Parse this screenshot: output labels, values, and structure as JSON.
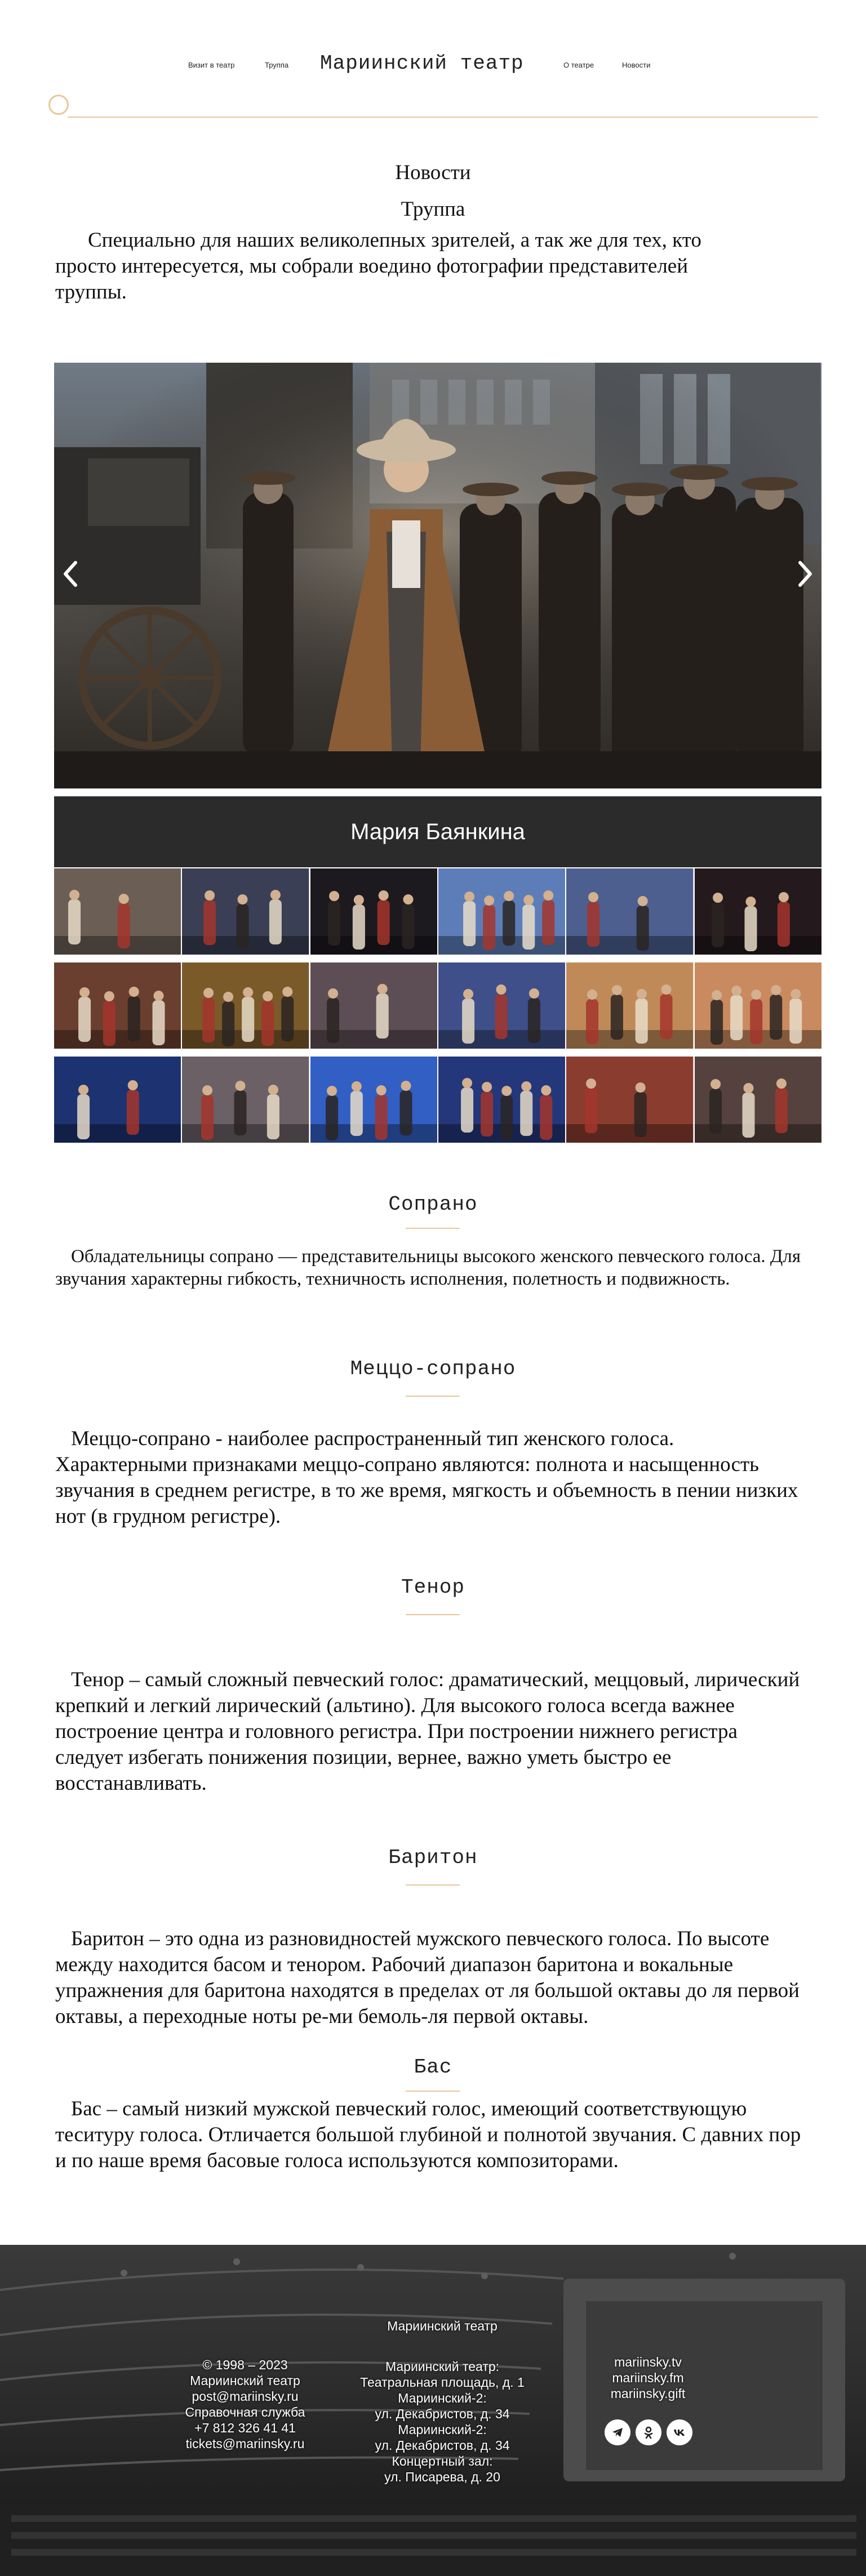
{
  "header": {
    "site_title": "Мариинский театр",
    "nav": {
      "visit": "Визит в театр",
      "troupe": "Труппа",
      "about": "О театре",
      "news": "Новости"
    }
  },
  "intro": {
    "news_heading": "Новости",
    "troupe_heading": "Труппа",
    "text": "Специально для наших великолепных зрителей, а так же для тех, кто просто интересуется, мы собрали воедино фотографии представителей труппы."
  },
  "slider": {
    "caption": "Мария Баянкина",
    "prev_icon": "chevron-left-icon",
    "next_icon": "chevron-right-icon"
  },
  "thumbnails": {
    "count": 18,
    "colors": [
      "#6b5f55",
      "#3a3f55",
      "#1c1a1f",
      "#5d7db8",
      "#4c5f8f",
      "#24191c",
      "#6a3f2f",
      "#7b5a2a",
      "#5d4e55",
      "#3e4f8a",
      "#c08a58",
      "#c98a5f",
      "#1d3270",
      "#6b6066",
      "#315fc3",
      "#23377a",
      "#8a3c2e",
      "#55423e"
    ]
  },
  "sections": {
    "soprano": {
      "title": "Сопрано",
      "text": "Обладательницы сопрано — представительницы высокого женского певческого голоса. Для звучания характерны гибкость, техничность исполнения, полетность и подвижность."
    },
    "mezzo": {
      "title": "Меццо-сопрано",
      "text": "Меццо-сопрано - наиболее распространенный тип женского голоса. Характерными признаками меццо-сопрано являются: полнота и насыщенность звучания в среднем регистре, в то же время, мягкость и объемность в пении низких нот (в грудном регистре)."
    },
    "tenor": {
      "title": "Тенор",
      "text": "Тенор – самый сложный певческий голос: драматический, меццовый, лирический крепкий и легкий лирический (альтино). Для высокого голоса всегда важнее построение центра и головного регистра. При построении нижнего регистра следует избегать понижения позиции, вернее, важно уметь быстро ее восстанавливать."
    },
    "baritone": {
      "title": "Баритон",
      "text": "Баритон – это одна из разновидностей мужского певческого голоса. По высоте между находится басом и тенором. Рабочий диапазон баритона и вокальные упражнения для баритона находятся в пределах от ля большой октавы до ля первой октавы, а переходные ноты ре-ми бемоль-ля первой октавы."
    },
    "bass": {
      "title": "Бас",
      "text": "Бас – самый низкий мужской певческий голос, имеющий соответствующую теситуру голоса. Отличается большой глубиной и полнотой звучания. С давних пор и по наше время басовые голоса используются композиторами."
    }
  },
  "footer": {
    "copyright": "© 1998 – 2023",
    "org_name": "Мариинский театр",
    "email": "post@mariinsky.ru",
    "help_label": "Справочная служба",
    "phone": "+7 812 326 41 41",
    "tickets_email": "tickets@mariinsky.ru",
    "middle_title": "Мариинский театр",
    "addresses": [
      "Мариинский театр:",
      "Театральная площадь, д. 1",
      "Мариинский-2:",
      "ул. Декабристов, д. 34",
      "Мариинский-2:",
      "ул. Декабристов, д. 34",
      "Концертный зал:",
      "ул. Писарева, д. 20"
    ],
    "links": [
      "mariinsky.tv",
      "mariinsky.fm",
      "mariinsky.gift"
    ],
    "social": {
      "telegram_icon": "telegram-icon",
      "ok_icon": "odnoklassniki-icon",
      "vk_icon": "vk-icon"
    }
  }
}
